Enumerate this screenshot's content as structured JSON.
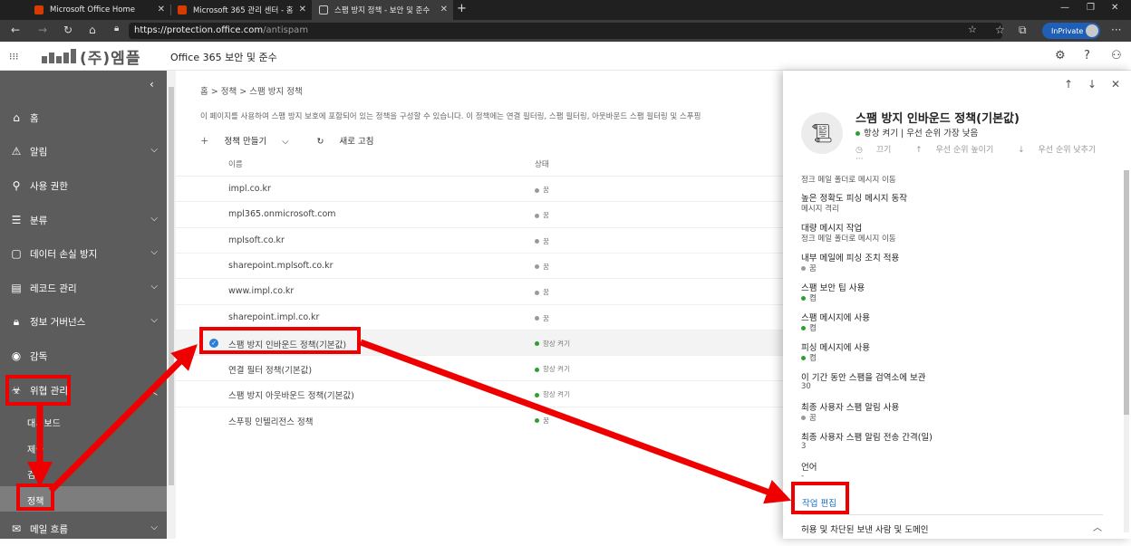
{
  "browser": {
    "tabs": [
      {
        "title": "Microsoft Office Home",
        "favicon_color": "#d83b01"
      },
      {
        "title": "Microsoft 365 관리 센터 - 홈",
        "favicon_color": "#d83b01"
      },
      {
        "title": "스팸 방지 정책 - 보안 및 준수",
        "favicon_color": "#cccccc"
      }
    ],
    "new_tab": "+",
    "url_host": "https://protection.office.com",
    "url_path": "/antispam",
    "inprivate_label": "InPrivate"
  },
  "app": {
    "logo_text": "(주)엠플",
    "title": "Office 365 보안 및 준수"
  },
  "nav": {
    "items": [
      {
        "label": "홈",
        "icon": "home-icon"
      },
      {
        "label": "알림",
        "icon": "alert-icon"
      },
      {
        "label": "사용 권한",
        "icon": "permissions-icon"
      },
      {
        "label": "분류",
        "icon": "classification-icon"
      },
      {
        "label": "데이터 손실 방지",
        "icon": "dlp-icon"
      },
      {
        "label": "레코드 관리",
        "icon": "records-icon"
      },
      {
        "label": "정보 거버넌스",
        "icon": "lock-icon"
      },
      {
        "label": "감독",
        "icon": "eye-icon"
      },
      {
        "label": "위협 관리",
        "icon": "biohazard-icon"
      },
      {
        "label": "메일 흐름",
        "icon": "mail-icon"
      }
    ],
    "sub_items": [
      "대시보드",
      "제출",
      "검토",
      "정책"
    ]
  },
  "main": {
    "breadcrumb": "홈     > 정책  >  스팸 방지 정책",
    "description": "이 페이지를 사용하여 스팸 방지 보호에 포함되어 있는 정책을 구성할 수 있습니다. 이 정책에는 연결 필터링, 스팸 필터링, 아웃바운드 스팸 필터링 및 스푸핑",
    "create_policy": "정책 만들기",
    "refresh": "새로 고침",
    "col_name": "이름",
    "col_status": "상태",
    "rows": [
      {
        "name": "impl.co.kr",
        "status": "꿈",
        "on": false
      },
      {
        "name": "mpl365.onmicrosoft.com",
        "status": "꿈",
        "on": false
      },
      {
        "name": "mplsoft.co.kr",
        "status": "꿈",
        "on": false
      },
      {
        "name": "sharepoint.mplsoft.co.kr",
        "status": "꿈",
        "on": false
      },
      {
        "name": "www.impl.co.kr",
        "status": "꿈",
        "on": false
      },
      {
        "name": "sharepoint.impl.co.kr",
        "status": "꿈",
        "on": false
      },
      {
        "name": "스팸 방지 인바운드 정책(기본값)",
        "status": "항상 켜기",
        "on": true
      },
      {
        "name": "연결 필터 정책(기본값)",
        "status": "항상 켜기",
        "on": true
      },
      {
        "name": "스팸 방지 아웃바운드 정책(기본값)",
        "status": "항상 켜기",
        "on": true
      },
      {
        "name": "스푸핑 인텔리전스 정책",
        "status": "꿈",
        "on": true
      }
    ]
  },
  "panel": {
    "title": "스팸 방지 인바운드 정책(기본값)",
    "subtitle": "항상 켜기 | 우선 순위 가장 낮음",
    "actions": [
      "끄기",
      "우선 순위 높이기",
      "우선 순위 낮추기"
    ],
    "more": "···",
    "fields": [
      {
        "label": "",
        "value": "정크 메일 폴더로 메시지 이동"
      },
      {
        "label": "높은 정확도 피싱 메시지 동작",
        "value": "메시지 격리"
      },
      {
        "label": "대량 메시지 작업",
        "value": "정크 메일 폴더로 메시지 이동"
      },
      {
        "label": "내부 메일에 피싱 조치 적용",
        "value": "꿈"
      },
      {
        "label": "스팸 보안 팁 사용",
        "value": "켬"
      },
      {
        "label": "스팸 메시지에 사용",
        "value": "켬"
      },
      {
        "label": "피싱 메시지에 사용",
        "value": "켬"
      },
      {
        "label": "이 기간 동안 스팸을 검역소에 보관",
        "value": "30"
      },
      {
        "label": "최종 사용자 스팸 알림 사용",
        "value": "꿈"
      },
      {
        "label": "최종 사용자 스팸 알림 전송 간격(일)",
        "value": "3"
      },
      {
        "label": "언어",
        "value": "-"
      }
    ],
    "edit_action": "작업 편집",
    "allow_block": "허용 및 차단된 보낸 사람 및 도메인"
  },
  "colors": {
    "annotation_red": "#ee0000",
    "status_green": "#2ca02c",
    "status_gray": "#999999",
    "nav_bg": "#5c5c5c",
    "link_blue": "#1a6fc9"
  }
}
